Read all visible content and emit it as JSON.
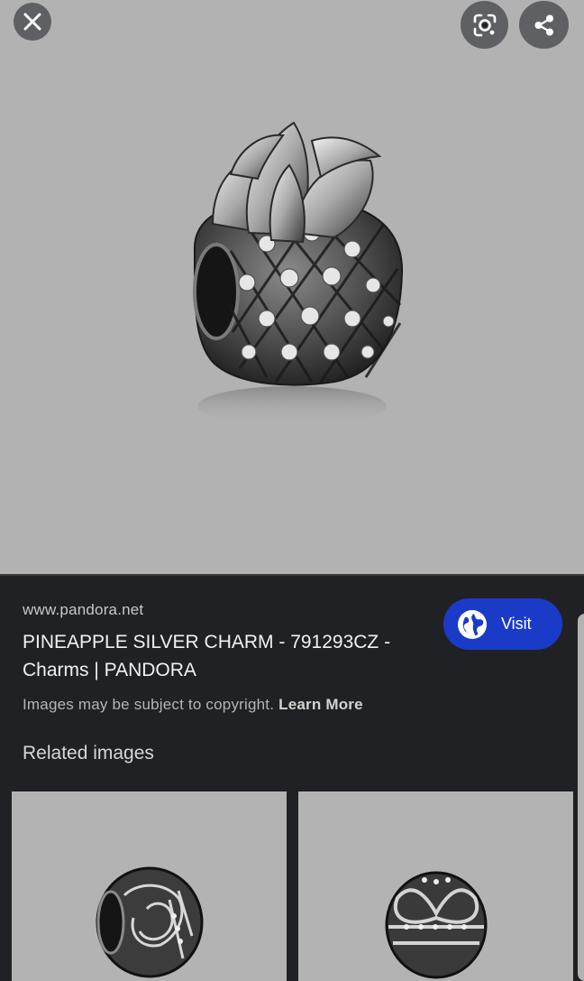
{
  "viewer": {
    "close_icon": "close-icon",
    "lens_icon": "google-lens-icon",
    "share_icon": "share-icon",
    "background_color": "#b2b2b2"
  },
  "result": {
    "source": "www.pandora.net",
    "title": "PINEAPPLE SILVER CHARM - 791293CZ - Charms | PANDORA",
    "visit_label": "Visit",
    "visit_icon": "globe-icon",
    "visit_color": "#1a3bc8",
    "copyright_text": "Images may be subject to copyright.",
    "learn_more": "Learn More"
  },
  "related": {
    "heading": "Related images"
  }
}
